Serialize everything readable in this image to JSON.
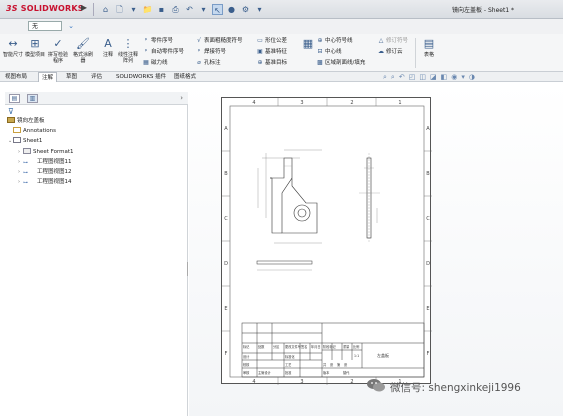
{
  "app": {
    "logo_ds": "3S",
    "logo_name": "SOLIDWORKS",
    "document_title": "镜向左盖板 - Sheet1 *"
  },
  "toolbar": {
    "dropdown_value": "无",
    "quick_access_icons": [
      "home-icon",
      "new-icon",
      "open-icon",
      "save-icon",
      "print-icon",
      "undo-icon",
      "select-icon",
      "rebuild-icon",
      "options-icon"
    ]
  },
  "ribbon": {
    "big_buttons": [
      {
        "label": "智能尺寸",
        "icon": "dimension-icon"
      },
      {
        "label": "模型项目",
        "icon": "model-items-icon"
      },
      {
        "label": "拼写检验程序",
        "icon": "spell-check-icon"
      },
      {
        "label": "格式涂刷器",
        "icon": "format-painter-icon"
      },
      {
        "label": "注释",
        "icon": "note-icon"
      },
      {
        "label": "线性注释阵列",
        "icon": "pattern-icon"
      }
    ],
    "col1": [
      "零件序号",
      "自动零件序号",
      "磁力线"
    ],
    "col2": [
      "表面粗糙度符号",
      "焊接符号",
      "孔标注"
    ],
    "col3": [
      "形位公差",
      "基准特征",
      "基准目标"
    ],
    "col4": [
      "中心符号线",
      "中心线",
      "区域剖面线/填充"
    ],
    "col5": [
      "修订符号",
      "修订云"
    ],
    "table_label": "表格"
  },
  "tabs": [
    "视图布局",
    "注解",
    "草图",
    "评估",
    "SOLIDWORKS 插件",
    "图纸格式"
  ],
  "active_tab": 1,
  "tree": {
    "root": "镜向左盖板",
    "annotations": "Annotations",
    "sheet": "Sheet1",
    "sheet_format": "Sheet Format1",
    "views": [
      "工程图视图11",
      "工程图视图12",
      "工程图视图14"
    ]
  },
  "sheet": {
    "col_labels": [
      "4",
      "3",
      "2",
      "1"
    ],
    "row_labels": [
      "A",
      "B",
      "C",
      "D",
      "E",
      "F"
    ],
    "title_block": {
      "name": "左盖板",
      "scale": "1:1",
      "cells": [
        "标记",
        "处数",
        "分区",
        "更改文件号",
        "签名",
        "年月日",
        "设计",
        "标准化",
        "校核",
        "审核",
        "主管设计",
        "工艺",
        "批准",
        "阶段标记",
        "重量",
        "比例",
        "共",
        "张",
        "第",
        "张",
        "版本",
        "替代"
      ]
    }
  },
  "watermark": "微信号: shengxinkeji1996"
}
